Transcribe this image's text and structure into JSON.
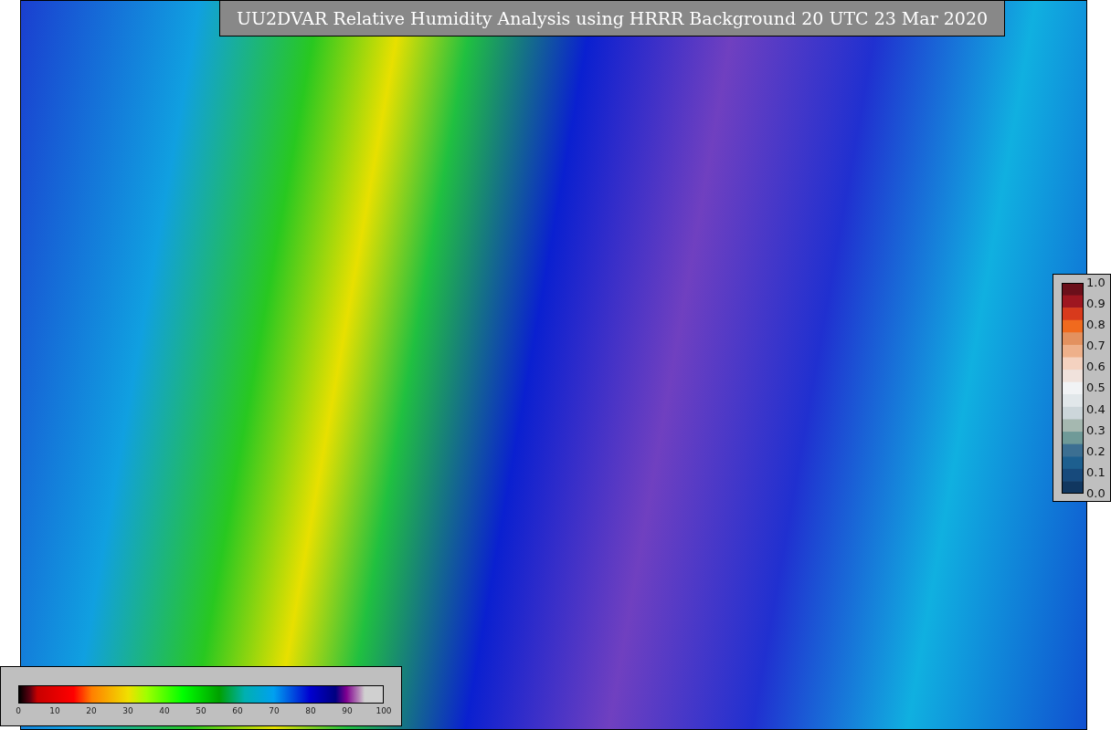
{
  "title": "UU2DVAR Relative Humidity Analysis using HRRR Background 20 UTC 23 Mar 2020",
  "humidity_colorbar": {
    "ticks": [
      "0",
      "10",
      "20",
      "30",
      "40",
      "50",
      "60",
      "70",
      "80",
      "90",
      "100"
    ]
  },
  "observation_colorbar": {
    "ticks": [
      "1.0",
      "0.9",
      "0.8",
      "0.7",
      "0.6",
      "0.5",
      "0.4",
      "0.3",
      "0.2",
      "0.1",
      "0.0"
    ]
  }
}
